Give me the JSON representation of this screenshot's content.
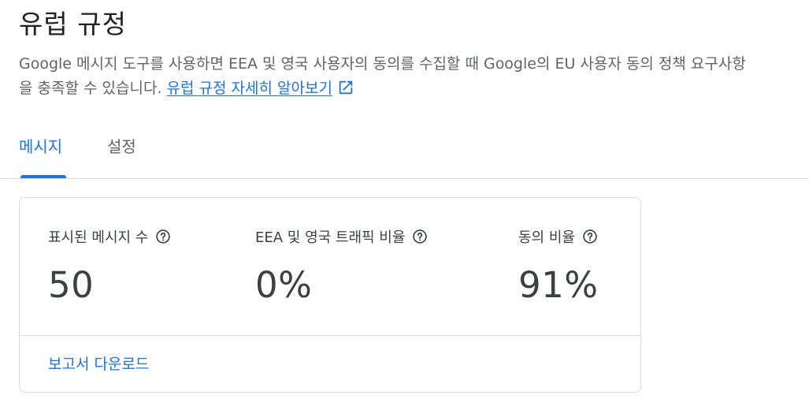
{
  "header": {
    "title": "유럽 규정",
    "description": "Google 메시지 도구를 사용하면 EEA 및 영국 사용자의 동의를 수집할 때 Google의 EU 사용자 동의 정책 요구사항을 충족할 수 있습니다.",
    "learn_more_link": "유럽 규정 자세히 알아보기",
    "link_icon": "open-in-new-icon"
  },
  "tabs": [
    {
      "label": "메시지",
      "active": true
    },
    {
      "label": "설정",
      "active": false
    }
  ],
  "card": {
    "stats": [
      {
        "label": "표시된 메시지 수",
        "value": "50",
        "icon": "help-icon"
      },
      {
        "label": "EEA 및 영국 트래픽 비율",
        "value": "0%",
        "icon": "help-icon"
      },
      {
        "label": "동의 비율",
        "value": "91%",
        "icon": "help-icon"
      }
    ],
    "download_label": "보고서 다운로드"
  },
  "colors": {
    "accent": "#1a73e8",
    "text_primary": "#202124",
    "text_secondary": "#5f6368",
    "border": "#dadce0"
  }
}
